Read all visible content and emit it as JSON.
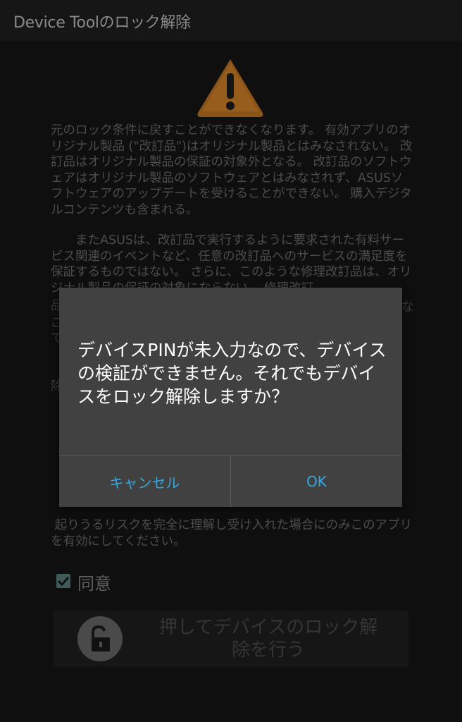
{
  "app_bar": {
    "title": "Device Toolのロック解除"
  },
  "terms": {
    "paragraph1": "元のロック条件に戻すことができなくなります。 有効アプリのオリジナル製品 (\"改訂品\")はオリジナル製品とはみなされない。 改訂品はオリジナル製品の保証の対象外となる。 改訂品のソフトウェアはオリジナル製品のソフトウェアとはみなされず、ASUSソフトウェアのアップデートを受けることができない。 購入デジタルコンテンツも含まれる。",
    "paragraph2": "　　またASUSは、改訂品で実行するように要求された有料サービス関連のイベントなど、任意の改訂品へのサービスの満足度を保証するものではない。 さらに、このような修理改訂品は、オリジナル製品の保証の対象にならない。 修理改訂",
    "fragment_a": "品",
    "fragment_b": "ご",
    "fragment_c": "て",
    "fragment_d": "除",
    "fragment_right": "な",
    "paragraph3": " 起りうるリスクを完全に理解し受け入れた場合にのみこのアプリを有効にしてください。"
  },
  "agree": {
    "label": "同意",
    "checked": true
  },
  "unlock_button": {
    "label_line1": "押してデバイスのロック解",
    "label_line2": "除を行う"
  },
  "dialog": {
    "message": "デバイスPINが未入力なので、デバイスの検証ができません。それでもデバイスをロック解除しますか？",
    "cancel_label": "キャンセル",
    "ok_label": "OK"
  },
  "colors": {
    "accent": "#37a7e0",
    "warning": "#c27b1f",
    "dialog_bg": "#414141"
  }
}
